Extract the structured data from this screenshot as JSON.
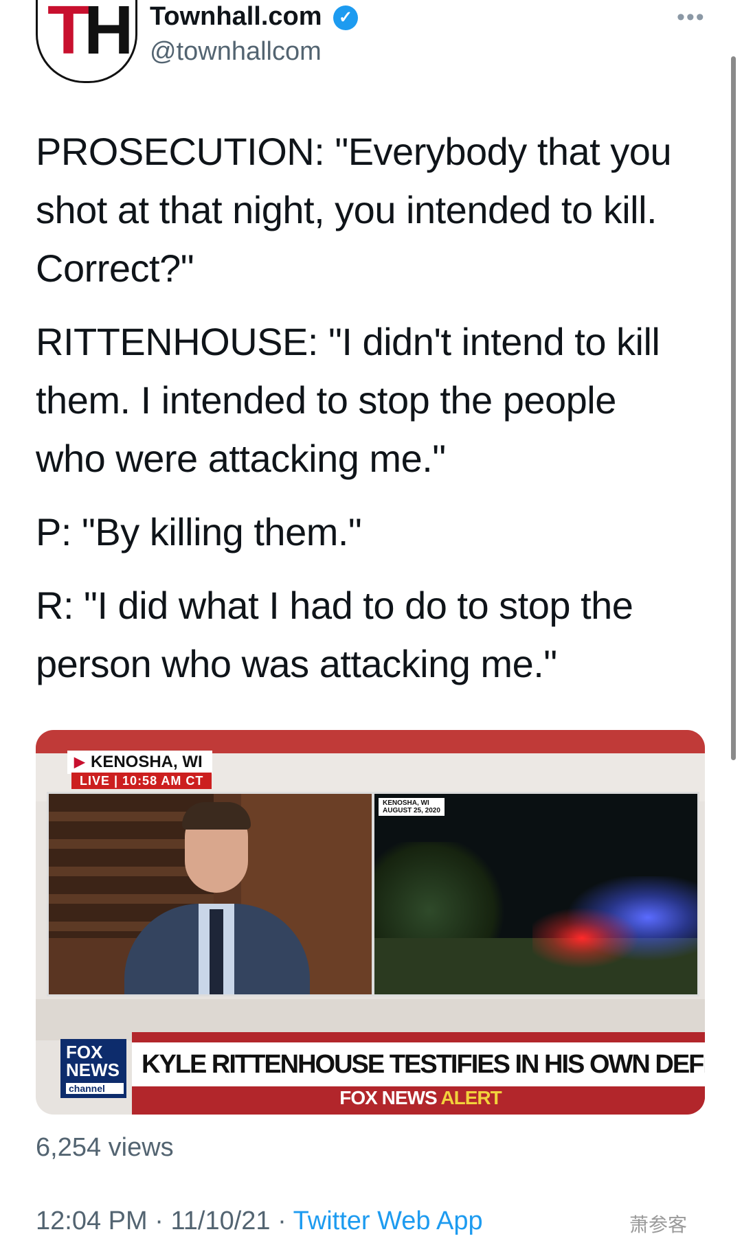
{
  "header": {
    "display_name": "Townhall.com",
    "handle": "@townhallcom",
    "avatar_text": "TH",
    "verified_icon": "verified-badge-icon",
    "more_icon": "more-options-icon"
  },
  "tweet": {
    "paragraphs": [
      "PROSECUTION: \"Everybody that you shot at that night, you intended to kill. Correct?\"",
      "RITTENHOUSE: \"I didn't intend to kill them. I intended to stop the people who were attacking me.\"",
      "P: \"By killing them.\"",
      "R: \"I did what I had to do to stop the person who was attacking me.\""
    ]
  },
  "media": {
    "location": "KENOSHA, WI",
    "live": "LIVE | 10:58 AM CT",
    "right_caption": "KENOSHA, WI\nAUGUST 25, 2020",
    "network_logo": "FOX NEWS",
    "network_sub": "channel",
    "headline": "KYLE RITTENHOUSE TESTIFIES IN HIS OWN DEFENSE",
    "alert_prefix": "FOX NEWS",
    "alert_suffix": "ALERT"
  },
  "stats": {
    "views": "6,254 views"
  },
  "meta": {
    "time": "12:04 PM",
    "date": "11/10/21",
    "separator": "·",
    "source": "Twitter Web App"
  },
  "watermark": "萧参客",
  "colors": {
    "accent": "#1d9bf0",
    "fox_red": "#b2262b",
    "fox_blue": "#0d2c6c"
  }
}
